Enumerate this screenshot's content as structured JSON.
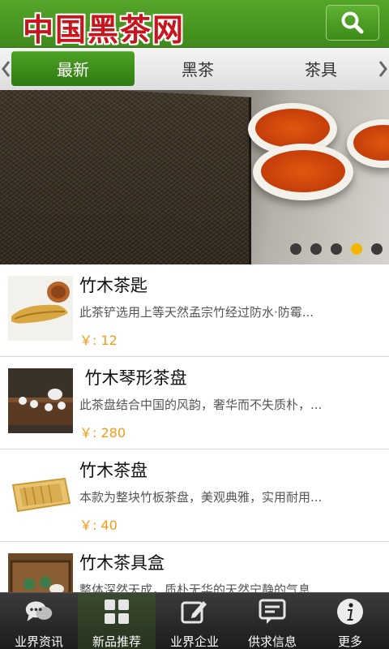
{
  "header": {
    "logo": "中国黑茶网"
  },
  "category_tabs": {
    "items": [
      {
        "label": "最新",
        "active": true
      },
      {
        "label": "黑茶",
        "active": false
      },
      {
        "label": "茶具",
        "active": false
      }
    ]
  },
  "banner": {
    "slide_count": 5,
    "active_slide": 4
  },
  "products": [
    {
      "title": "竹木茶匙",
      "desc": "此茶铲选用上等天然孟宗竹经过防水·防霉...",
      "price": "￥: 12"
    },
    {
      "title": " 竹木琴形茶盘",
      "desc": "此茶盘结合中国的风韵，奢华而不失质朴，...",
      "price": "￥: 280"
    },
    {
      "title": "竹木茶盘",
      "desc": "本款为整块竹板茶盘，美观典雅，实用耐用...",
      "price": "￥: 40"
    },
    {
      "title": "竹木茶具盒",
      "desc": "整体深然天成，质朴无华的天然宁静的气息...",
      "price": ""
    }
  ],
  "bottom_nav": {
    "items": [
      {
        "label": "业界资讯",
        "icon": "chat-bubbles-icon",
        "active": false
      },
      {
        "label": "新品推荐",
        "icon": "grid-icon",
        "active": true
      },
      {
        "label": "业界企业",
        "icon": "edit-icon",
        "active": false
      },
      {
        "label": "供求信息",
        "icon": "message-icon",
        "active": false
      },
      {
        "label": "更多",
        "icon": "info-icon",
        "active": false
      }
    ]
  },
  "colors": {
    "brand_green": "#4a9a22",
    "logo_red": "#c8141c",
    "price_orange": "#f39a16",
    "active_dot": "#f2b705"
  }
}
